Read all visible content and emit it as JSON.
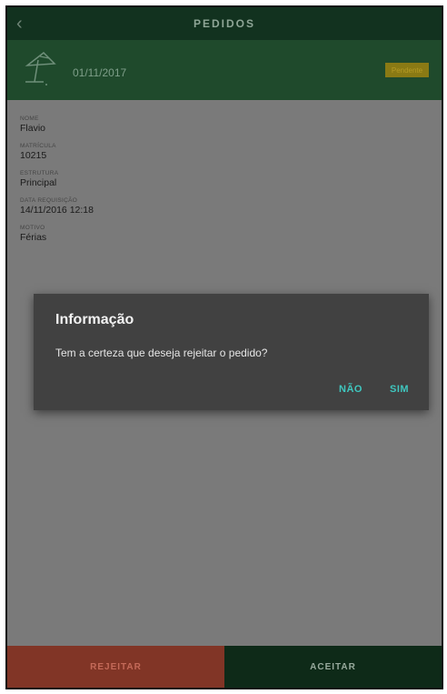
{
  "topbar": {
    "back_glyph": "‹",
    "title": "PEDIDOS"
  },
  "header": {
    "icon": "beach-umbrella-icon",
    "date": "01/11/2017",
    "status": "Pendente"
  },
  "fields": [
    {
      "label": "NOME",
      "value": "Flavio"
    },
    {
      "label": "MATRÍCULA",
      "value": "10215"
    },
    {
      "label": "ESTRUTURA",
      "value": "Principal"
    },
    {
      "label": "DATA REQUISIÇÃO",
      "value": "14/11/2016 12:18"
    },
    {
      "label": "MOTIVO",
      "value": "Férias"
    }
  ],
  "dialog": {
    "title": "Informação",
    "message": "Tem a certeza que deseja rejeitar o pedido?",
    "no_label": "NÃO",
    "yes_label": "SIM"
  },
  "actions": {
    "reject_label": "REJEITAR",
    "accept_label": "ACEITAR"
  },
  "colors": {
    "topbar": "#12321f",
    "header": "#1f4a2c",
    "badge": "#8a7a14",
    "dialog_bg": "#414141",
    "dialog_accent": "#3fc7bf",
    "reject": "#813526",
    "accept": "#0e2a18"
  }
}
